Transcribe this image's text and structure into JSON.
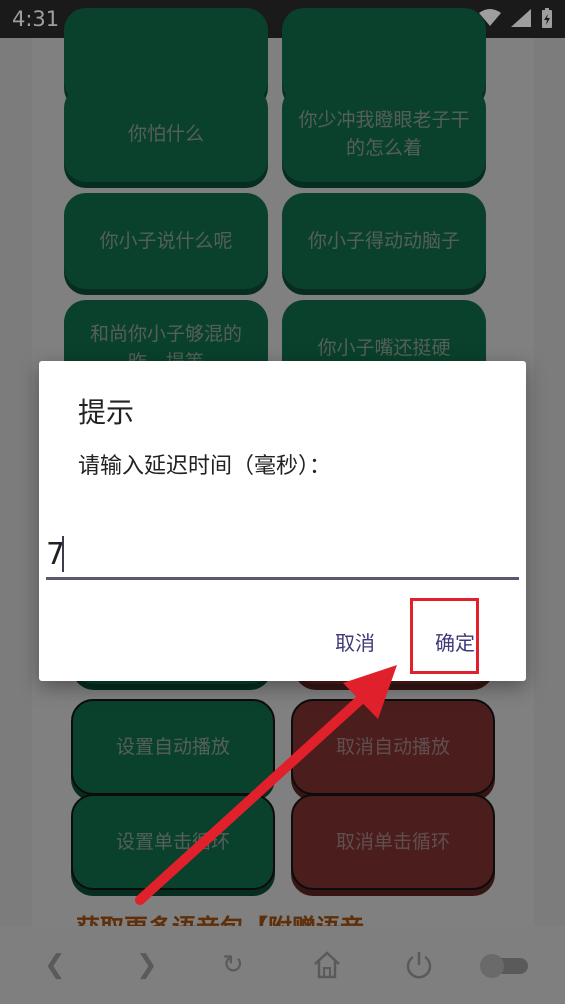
{
  "status_bar": {
    "time": "4:31"
  },
  "buttons": [
    {
      "label": "",
      "style": "green"
    },
    {
      "label": "",
      "style": "green"
    },
    {
      "label": "你怕什么",
      "style": "green"
    },
    {
      "label": "你少冲我瞪眼老子干的怎么着",
      "style": "green"
    },
    {
      "label": "你小子说什么呢",
      "style": "green"
    },
    {
      "label": "你小子得动动脑子",
      "style": "green"
    },
    {
      "label": "和尚你小子够混的昨…提等",
      "style": "green"
    },
    {
      "label": "你小子嘴还挺硬",
      "style": "green"
    },
    {
      "label": "",
      "style": "green"
    },
    {
      "label": "",
      "style": "red"
    },
    {
      "label": "设置自动播放",
      "style": "green"
    },
    {
      "label": "取消自动播放",
      "style": "red"
    },
    {
      "label": "设置单击循环",
      "style": "green"
    },
    {
      "label": "取消单击循环",
      "style": "red"
    }
  ],
  "promo_text": "获取更多语音包【附赠语音",
  "dialog": {
    "title": "提示",
    "message": "请输入延迟时间（毫秒）：",
    "input_value": "7",
    "cancel_label": "取消",
    "ok_label": "确定"
  },
  "colors": {
    "green_button": "#0f6a47",
    "red_button": "#7a2f30",
    "dialog_button_text": "#3f3a7a",
    "annotation_red": "#e0202a"
  },
  "nav_icons": [
    "back-icon",
    "forward-icon",
    "refresh-icon",
    "home-icon",
    "power-icon",
    "toggle-icon"
  ]
}
